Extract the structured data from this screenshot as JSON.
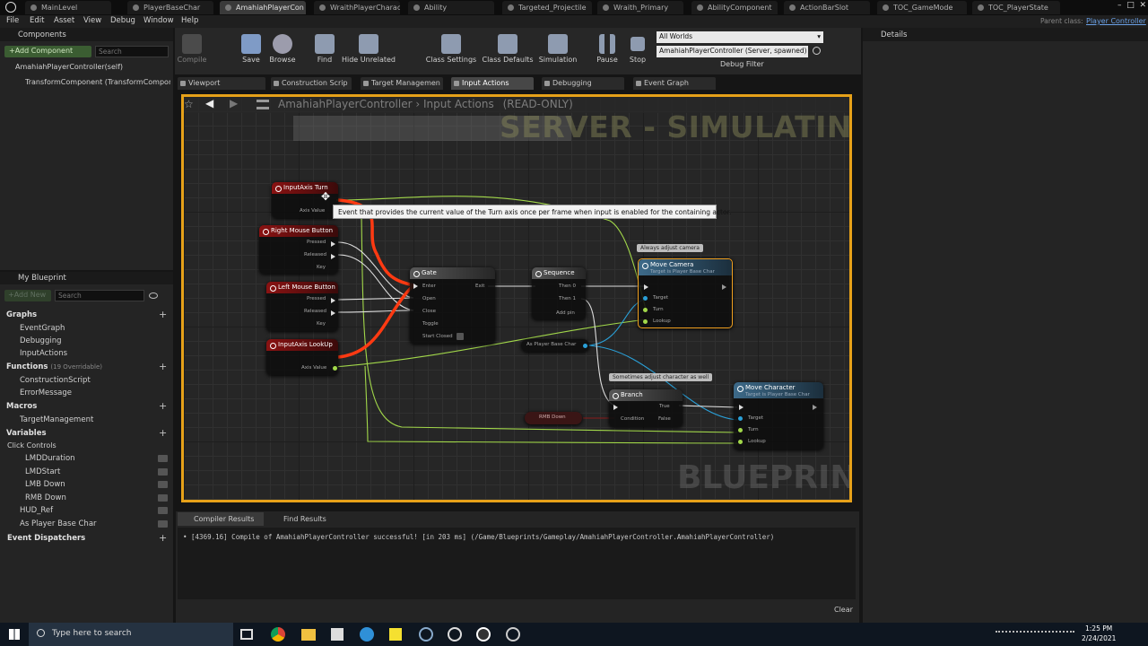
{
  "tabs": [
    "MainLevel",
    "PlayerBaseChar",
    "AmahiahPlayerCon",
    "WraithPlayerCharac",
    "Ability",
    "Targeted_Projectile",
    "Wraith_Primary",
    "AbilityComponent",
    "ActionBarSlot",
    "TOC_GameMode",
    "TOC_PlayerState"
  ],
  "parent_class": {
    "label": "Parent class:",
    "value": "Player Controller"
  },
  "menu": [
    "File",
    "Edit",
    "Asset",
    "View",
    "Debug",
    "Window",
    "Help"
  ],
  "components": {
    "title": "Components",
    "add_label": "+Add Component",
    "search_placeholder": "Search",
    "self_item": "AmahiahPlayerController(self)",
    "transform_item": "TransformComponent (TransformComponen"
  },
  "toolbar": {
    "compile": "Compile",
    "save": "Save",
    "browse": "Browse",
    "find": "Find",
    "hide_unrelated": "Hide Unrelated",
    "class_settings": "Class Settings",
    "class_defaults": "Class Defaults",
    "simulation": "Simulation",
    "pause": "Pause",
    "stop": "Stop"
  },
  "debug": {
    "world": "All Worlds",
    "object": "AmahiahPlayerController (Server, spawned)",
    "filter_label": "Debug Filter"
  },
  "details": {
    "title": "Details"
  },
  "graph_tabs": [
    "Viewport",
    "Construction Scrip",
    "Target Managemen",
    "Input Actions",
    "Debugging",
    "Event Graph"
  ],
  "breadcrumb": {
    "root": "AmahiahPlayerController",
    "separator": "›",
    "current": "Input Actions",
    "readonly": "(READ-ONLY)"
  },
  "watermarks": {
    "top": "SERVER - SIMULATING",
    "bottom": "BLUEPRINT"
  },
  "tooltip": "Event that provides the current value of the Turn axis once per frame when input is enabled for the containing actor.",
  "nodes": {
    "axis_turn": {
      "title": "InputAxis Turn",
      "pin": "Axis Value"
    },
    "rmb": {
      "title": "Right Mouse Button",
      "pins": [
        "Pressed",
        "Released",
        "Key"
      ]
    },
    "lmb": {
      "title": "Left Mouse Button",
      "pins": [
        "Pressed",
        "Released",
        "Key"
      ]
    },
    "axis_lookup": {
      "title": "InputAxis LookUp",
      "pin": "Axis Value"
    },
    "gate": {
      "title": "Gate",
      "pins": [
        "Enter",
        "Open",
        "Close",
        "Toggle",
        "Start Closed"
      ],
      "exit": "Exit"
    },
    "sequence": {
      "title": "Sequence",
      "pins": [
        "Then 0",
        "Then 1",
        "Add pin"
      ]
    },
    "move_camera": {
      "title": "Move Camera",
      "subtitle": "Target is Player Base Char",
      "pins": [
        "Target",
        "Turn",
        "Lookup"
      ]
    },
    "as_player_base_char": "As Player Base Char",
    "branch": {
      "title": "Branch",
      "pins": [
        "Condition",
        "True",
        "False"
      ]
    },
    "rmb_down": "RMB Down",
    "move_character": {
      "title": "Move Character",
      "subtitle": "Target is Player Base Char",
      "pins": [
        "Target",
        "Turn",
        "Lookup"
      ]
    }
  },
  "comments": {
    "camera": "Always adjust camera",
    "character": "Sometimes adjust character as well"
  },
  "my_blueprint": {
    "title": "My Blueprint",
    "add_label": "+Add New",
    "search_placeholder": "Search",
    "graphs_header": "Graphs",
    "graphs": [
      "EventGraph",
      "Debugging",
      "InputActions"
    ],
    "functions_header": "Functions",
    "functions_note": "(19 Overridable)",
    "functions": [
      "ConstructionScript",
      "ErrorMessage"
    ],
    "macros_header": "Macros",
    "macros": [
      "TargetManagement"
    ],
    "variables_header": "Variables",
    "var_category": "Click Controls",
    "variables": [
      "LMDDuration",
      "LMDStart",
      "LMB Down",
      "RMB Down",
      "HUD_Ref",
      "As Player Base Char"
    ],
    "dispatchers_header": "Event Dispatchers"
  },
  "bottom_tabs": [
    "Compiler Results",
    "Find Results"
  ],
  "log_line": "• [4369.16] Compile of AmahiahPlayerController successful! [in 203 ms] (/Game/Blueprints/Gameplay/AmahiahPlayerController.AmahiahPlayerController)",
  "clear_label": "Clear",
  "taskbar": {
    "search_placeholder": "Type here to search",
    "time": "1:25 PM",
    "date": "2/24/2021"
  },
  "colors": {
    "accent": "#e6a119",
    "exec_wire": "#ff3a12",
    "float_wire": "#a2d84a",
    "object_wire": "#2aa0d8"
  }
}
